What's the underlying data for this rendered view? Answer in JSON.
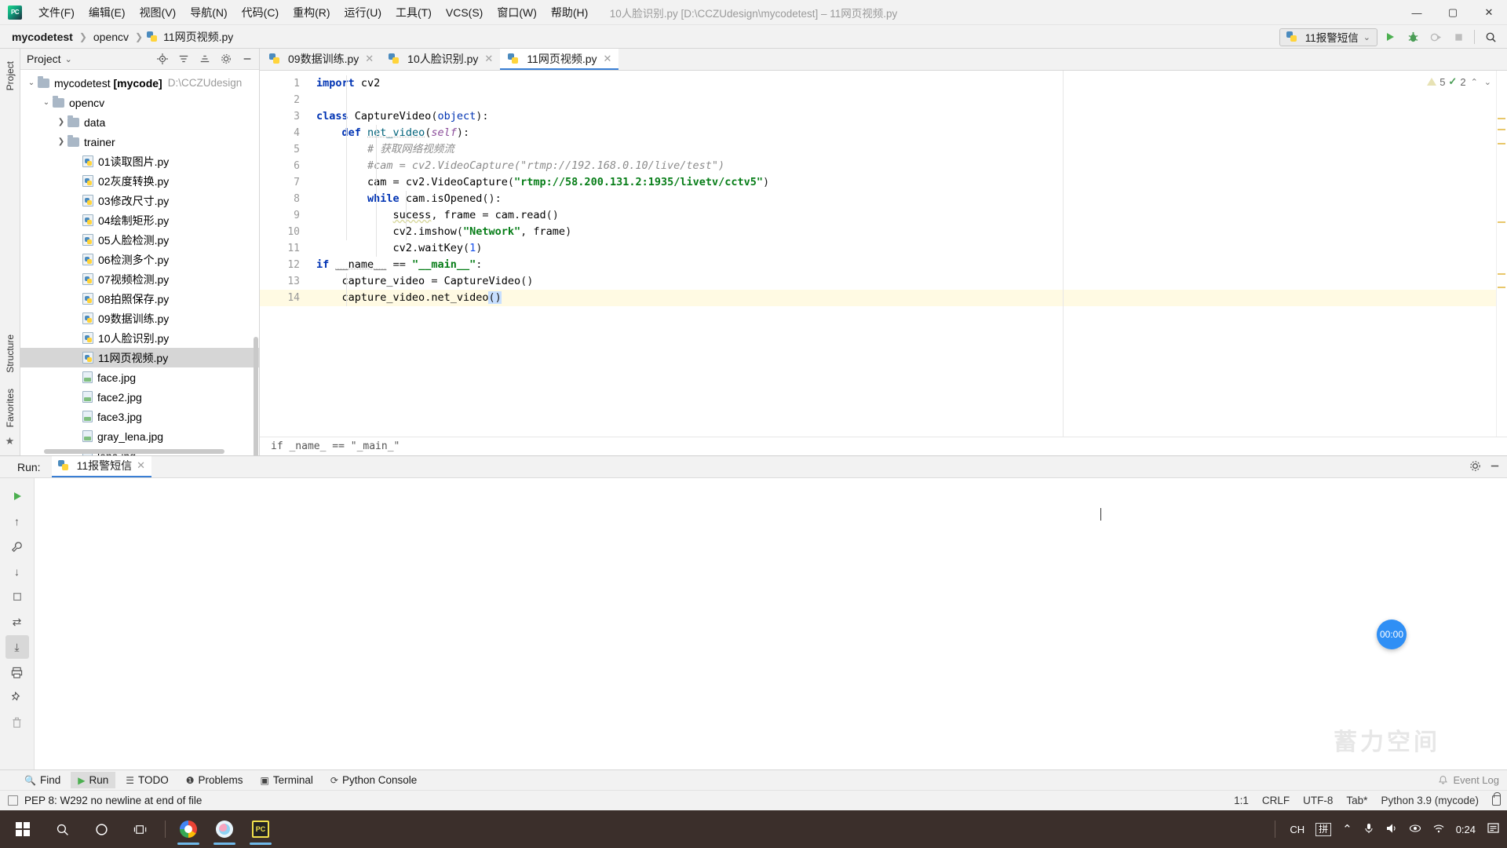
{
  "titlebar": {
    "app_logo": "pycharm-logo",
    "menus": [
      "文件(F)",
      "编辑(E)",
      "视图(V)",
      "导航(N)",
      "代码(C)",
      "重构(R)",
      "运行(U)",
      "工具(T)",
      "VCS(S)",
      "窗口(W)",
      "帮助(H)"
    ],
    "window_title": "10人脸识别.py [D:\\CCZUdesign\\mycodetest] – 11网页视频.py",
    "minimize": "—",
    "maximize": "▢",
    "close": "✕"
  },
  "navbar": {
    "crumb_project": "mycodetest",
    "crumb_folder": "opencv",
    "crumb_file": "11网页视频.py",
    "sep": "❯",
    "run_config": "11报警短信",
    "dropdown_caret": "⌄",
    "run_icon": "run-icon",
    "debug_icon": "debug-icon",
    "coverage_icon": "run-with-coverage-icon",
    "stop_icon": "stop-icon",
    "search_icon": "search-everywhere-icon"
  },
  "left_rail": {
    "project_label": "Project",
    "structure_label": "Structure",
    "favorites_label": "Favorites",
    "star_icon": "★"
  },
  "project_panel": {
    "title": "Project",
    "caret": "⌄",
    "locate_icon": "locate-icon",
    "collapse_icon": "collapse-all-icon",
    "expand_icon": "expand-icon",
    "settings_icon": "gear-icon",
    "hide_icon": "hide-icon",
    "tree": [
      {
        "label": "mycodetest [mycode]",
        "suffix": "D:\\CCZUdesign",
        "indent": 0,
        "type": "folder-root",
        "twisty": "⌄",
        "selected": false
      },
      {
        "label": "opencv",
        "suffix": "",
        "indent": 1,
        "type": "folder",
        "twisty": "⌄",
        "selected": false
      },
      {
        "label": "data",
        "suffix": "",
        "indent": 2,
        "type": "folder",
        "twisty": "❯",
        "selected": false
      },
      {
        "label": "trainer",
        "suffix": "",
        "indent": 2,
        "type": "folder",
        "twisty": "❯",
        "selected": false
      },
      {
        "label": "01读取图片.py",
        "suffix": "",
        "indent": 3,
        "type": "py",
        "twisty": "",
        "selected": false
      },
      {
        "label": "02灰度转换.py",
        "suffix": "",
        "indent": 3,
        "type": "py",
        "twisty": "",
        "selected": false
      },
      {
        "label": "03修改尺寸.py",
        "suffix": "",
        "indent": 3,
        "type": "py",
        "twisty": "",
        "selected": false
      },
      {
        "label": "04绘制矩形.py",
        "suffix": "",
        "indent": 3,
        "type": "py",
        "twisty": "",
        "selected": false
      },
      {
        "label": "05人脸检测.py",
        "suffix": "",
        "indent": 3,
        "type": "py",
        "twisty": "",
        "selected": false
      },
      {
        "label": "06检测多个.py",
        "suffix": "",
        "indent": 3,
        "type": "py",
        "twisty": "",
        "selected": false
      },
      {
        "label": "07视频检测.py",
        "suffix": "",
        "indent": 3,
        "type": "py",
        "twisty": "",
        "selected": false
      },
      {
        "label": "08拍照保存.py",
        "suffix": "",
        "indent": 3,
        "type": "py",
        "twisty": "",
        "selected": false
      },
      {
        "label": "09数据训练.py",
        "suffix": "",
        "indent": 3,
        "type": "py",
        "twisty": "",
        "selected": false
      },
      {
        "label": "10人脸识别.py",
        "suffix": "",
        "indent": 3,
        "type": "py",
        "twisty": "",
        "selected": false
      },
      {
        "label": "11网页视频.py",
        "suffix": "",
        "indent": 3,
        "type": "py",
        "twisty": "",
        "selected": true
      },
      {
        "label": "face.jpg",
        "suffix": "",
        "indent": 3,
        "type": "img",
        "twisty": "",
        "selected": false
      },
      {
        "label": "face2.jpg",
        "suffix": "",
        "indent": 3,
        "type": "img",
        "twisty": "",
        "selected": false
      },
      {
        "label": "face3.jpg",
        "suffix": "",
        "indent": 3,
        "type": "img",
        "twisty": "",
        "selected": false
      },
      {
        "label": "gray_lena.jpg",
        "suffix": "",
        "indent": 3,
        "type": "img",
        "twisty": "",
        "selected": false
      },
      {
        "label": "lena.jpg",
        "suffix": "",
        "indent": 3,
        "type": "img",
        "twisty": "",
        "selected": false
      }
    ]
  },
  "editor": {
    "tabs": [
      {
        "label": "09数据训练.py",
        "active": false,
        "close": "✕"
      },
      {
        "label": "10人脸识别.py",
        "active": false,
        "close": "✕"
      },
      {
        "label": "11网页视频.py",
        "active": true,
        "close": "✕"
      }
    ],
    "line_numbers": [
      "1",
      "2",
      "3",
      "4",
      "5",
      "6",
      "7",
      "8",
      "9",
      "10",
      "11",
      "12",
      "13",
      "14"
    ],
    "highlight_line": 14,
    "inspection": {
      "warning_count": "5",
      "check_count": "2",
      "up_caret": "⌃",
      "down_caret": "⌄"
    },
    "breadcrumb_bottom": "if _name_ == \"_main_\"",
    "code_lines": [
      "import cv2",
      "",
      "class CaptureVideo(object):",
      "    def net_video(self):",
      "        # 获取网络视频流",
      "        #cam = cv2.VideoCapture(\"rtmp://192.168.0.10/live/test\")",
      "        cam = cv2.VideoCapture(\"rtmp://58.200.131.2:1935/livetv/cctv5\")",
      "        while cam.isOpened():",
      "            sucess, frame = cam.read()",
      "            cv2.imshow(\"Network\", frame)",
      "            cv2.waitKey(1)",
      "if __name__ == \"__main__\":",
      "    capture_video = CaptureVideo()",
      "    capture_video.net_video()"
    ]
  },
  "run_window": {
    "label": "Run:",
    "tab_name": "11报警短信",
    "tab_close": "✕",
    "settings_icon": "gear-icon",
    "hide_icon": "hide-icon",
    "toolbar": [
      {
        "name": "rerun-icon",
        "glyph": "▶"
      },
      {
        "name": "up-stack-icon",
        "glyph": "↑"
      },
      {
        "name": "wrench-icon",
        "glyph": "🔧"
      },
      {
        "name": "down-stack-icon",
        "glyph": "↓"
      },
      {
        "name": "stop-icon",
        "glyph": "■"
      },
      {
        "name": "soft-wrap-icon",
        "glyph": "⇄"
      },
      {
        "name": "scroll-to-end-icon",
        "glyph": "⤓"
      },
      {
        "name": "print-icon",
        "glyph": "🖶"
      },
      {
        "name": "pin-icon",
        "glyph": "📌"
      },
      {
        "name": "trash-icon",
        "glyph": "🗑"
      }
    ],
    "timer_badge": "00:00",
    "watermark": "蓄力空间"
  },
  "bottom_nav": {
    "items": [
      {
        "label": "Find",
        "icon": "search-icon",
        "glyph": "🔍",
        "active": false
      },
      {
        "label": "Run",
        "icon": "run-icon",
        "glyph": "▶",
        "active": true
      },
      {
        "label": "TODO",
        "icon": "todo-icon",
        "glyph": "☰",
        "active": false
      },
      {
        "label": "Problems",
        "icon": "problems-icon",
        "glyph": "❶",
        "active": false
      },
      {
        "label": "Terminal",
        "icon": "terminal-icon",
        "glyph": "▣",
        "active": false
      },
      {
        "label": "Python Console",
        "icon": "python-console-icon",
        "glyph": "⟳",
        "active": false
      }
    ],
    "event_log": "Event Log",
    "event_log_icon": "bell-icon"
  },
  "status_bar": {
    "message": "PEP 8: W292 no newline at end of file",
    "message_icon": "inspection-icon",
    "caret_position": "1:1",
    "line_separator": "CRLF",
    "encoding": "UTF-8",
    "indent": "Tab*",
    "interpreter": "Python 3.9 (mycode)",
    "lock_icon": "lock-icon"
  },
  "taskbar": {
    "start_icon": "windows-start-icon",
    "search_icon": "search-icon",
    "cortana_icon": "cortana-icon",
    "taskview_icon": "task-view-icon",
    "apps": [
      {
        "name": "chrome-icon"
      },
      {
        "name": "qq-icon"
      },
      {
        "name": "pycharm-icon",
        "label": "PC"
      }
    ],
    "tray": {
      "up_caret": "⌃",
      "ime_lang": "CH",
      "ime_mode": "拼",
      "mic_icon": "🎤",
      "volume_icon": "🔊",
      "eye_icon": "◉",
      "wifi_icon": "📶",
      "clock": "0:24",
      "notification_icon": "notification-icon"
    }
  },
  "colors": {
    "accent": "#3a7fd5",
    "keyword": "#0033b3",
    "string": "#067d17",
    "comment": "#8c8c8c",
    "number": "#1750eb",
    "selected_row": "#d6d6d6",
    "caret_line": "#fffae3",
    "badge_blue": "#2f8ff5"
  }
}
